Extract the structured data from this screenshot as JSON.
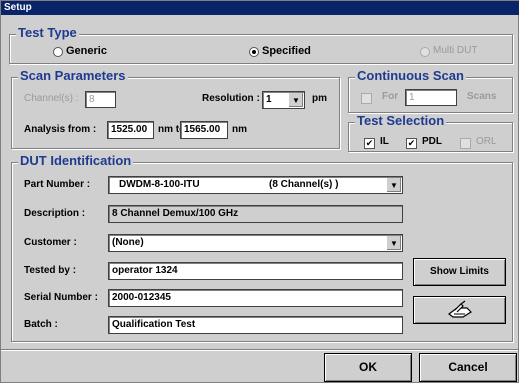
{
  "window": {
    "title": "Setup"
  },
  "test_type": {
    "legend": "Test Type",
    "options": [
      {
        "label": "Generic",
        "selected": false,
        "enabled": true
      },
      {
        "label": "Specified",
        "selected": true,
        "enabled": true
      },
      {
        "label": "Multi DUT",
        "selected": false,
        "enabled": false
      }
    ]
  },
  "scan_parameters": {
    "legend": "Scan Parameters",
    "channels_label": "Channel(s) :",
    "channels_value": "8",
    "resolution_label": "Resolution :",
    "resolution_value": "1",
    "resolution_unit": "pm",
    "analysis_label": "Analysis from :",
    "from_value": "1525.00",
    "nm_to_label": "nm to",
    "to_value": "1565.00",
    "nm_label": "nm"
  },
  "continuous_scan": {
    "legend": "Continuous Scan",
    "for_label": "For",
    "count_value": "1",
    "scans_label": "Scans"
  },
  "test_selection": {
    "legend": "Test Selection",
    "items": [
      {
        "label": "IL",
        "checked": true,
        "enabled": true
      },
      {
        "label": "PDL",
        "checked": true,
        "enabled": true
      },
      {
        "label": "ORL",
        "checked": false,
        "enabled": false
      }
    ]
  },
  "dut": {
    "legend": "DUT Identification",
    "part_number_label": "Part Number :",
    "part_number_value": "DWDM-8-100-ITU",
    "part_number_channels": "(8 Channel(s) )",
    "description_label": "Description :",
    "description_value": "8 Channel Demux/100 GHz",
    "customer_label": "Customer :",
    "customer_value": "(None)",
    "tested_by_label": "Tested by :",
    "tested_by_value": "operator 1324",
    "serial_label": "Serial Number :",
    "serial_value": "2000-012345",
    "batch_label": "Batch :",
    "batch_value": "Qualification Test",
    "show_limits_label": "Show Limits"
  },
  "footer": {
    "ok_label": "OK",
    "cancel_label": "Cancel"
  }
}
